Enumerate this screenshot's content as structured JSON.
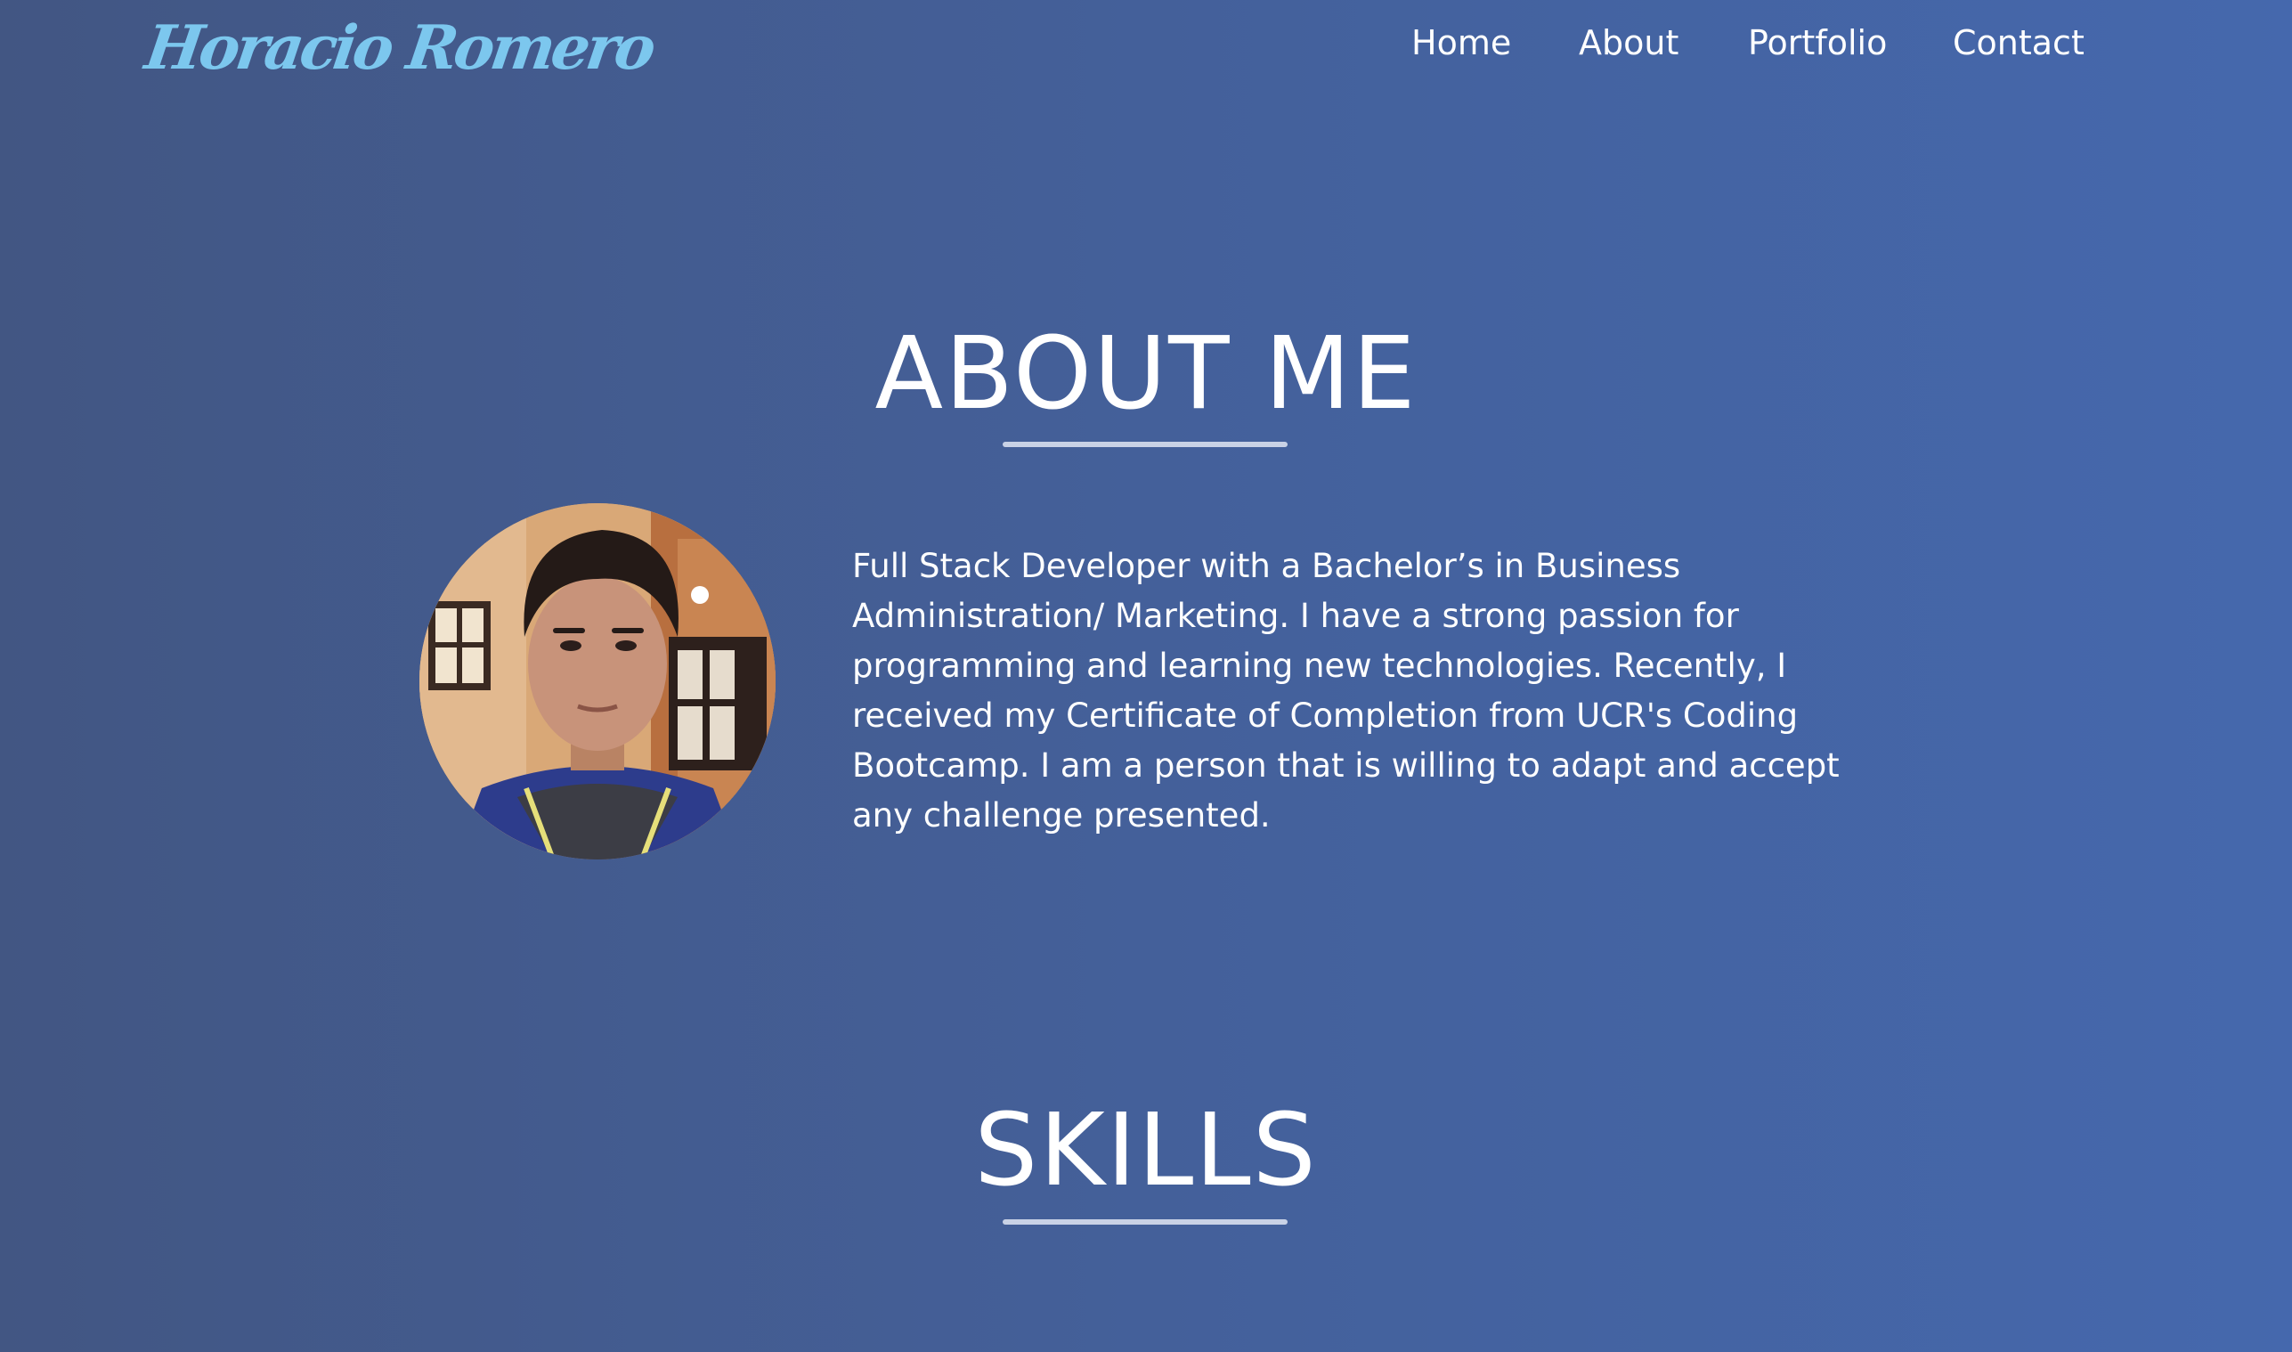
{
  "header": {
    "logo_text": "Horacio Romero",
    "nav": [
      {
        "label": "Home"
      },
      {
        "label": "About"
      },
      {
        "label": "Portfolio"
      },
      {
        "label": "Contact"
      }
    ]
  },
  "about": {
    "title": "ABOUT ME",
    "photo_icon": "profile-photo",
    "bio": "Full Stack Developer with a Bachelor’s in Business Administration/ Marketing. I have a strong passion for programming and learning new technologies. Recently, I received my Certificate of Completion from UCR's Coding Bootcamp. I am a person that is willing to adapt and accept any challenge presented."
  },
  "skills": {
    "title": "SKILLS"
  },
  "colors": {
    "background_left": "#425683",
    "background_right": "#4568ad",
    "logo": "#7cc7ee",
    "text": "#ffffff",
    "rule": "#c9d2e6"
  }
}
